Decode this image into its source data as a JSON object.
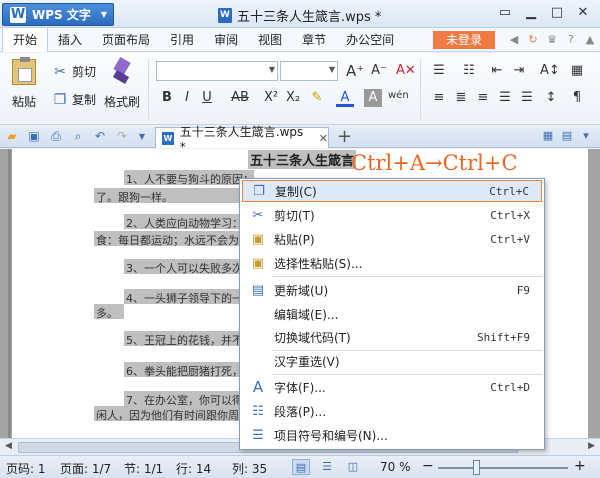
{
  "titlebar": {
    "app_name": "WPS 文字",
    "doc_title": "五十三条人生箴言.wps *",
    "win_ctrls": [
      "▭",
      "▁",
      "□",
      "✕"
    ]
  },
  "menubar": {
    "items": [
      "开始",
      "插入",
      "页面布局",
      "引用",
      "审阅",
      "视图",
      "章节",
      "办公空间"
    ],
    "login": "未登录"
  },
  "ribbon": {
    "paste": "粘贴",
    "cut": "剪切",
    "copy": "复制",
    "format_painter": "格式刷"
  },
  "tabbar": {
    "doc_tab": "五十三条人生箴言.wps *"
  },
  "document": {
    "heading": "五十三条人生箴言",
    "lines": [
      "1、人不要与狗斗的原因：",
      "了。跟狗一样。",
      "2、人类应向动物学习：",
      "食：每日都运动；水远不会为",
      "3、一个人可以失败多次，",
      "4、一头狮子领导下的一",
      "多。",
      "5、王冠上的花钱，并不",
      "6、拳头能把厨猪打死，",
      "7、在办公室，你可以得",
      "闲人，因为他们有时间跟你周"
    ],
    "overlay": "Ctrl+A→Ctrl+C"
  },
  "context_menu": {
    "items": [
      {
        "label": "复制(C)",
        "shortcut": "Ctrl+C"
      },
      {
        "label": "剪切(T)",
        "shortcut": "Ctrl+X"
      },
      {
        "label": "粘贴(P)",
        "shortcut": "Ctrl+V"
      },
      {
        "label": "选择性粘贴(S)...",
        "shortcut": ""
      },
      {
        "label": "更新域(U)",
        "shortcut": "F9"
      },
      {
        "label": "编辑域(E)...",
        "shortcut": ""
      },
      {
        "label": "切换域代码(T)",
        "shortcut": "Shift+F9"
      },
      {
        "label": "汉字重选(V)",
        "shortcut": ""
      },
      {
        "label": "字体(F)...",
        "shortcut": "Ctrl+D"
      },
      {
        "label": "段落(P)...",
        "shortcut": ""
      },
      {
        "label": "项目符号和编号(N)...",
        "shortcut": ""
      }
    ]
  },
  "statusbar": {
    "page_code": "页码: 1",
    "page": "页面: 1/7",
    "section": "节: 1/1",
    "row": "行: 14",
    "col": "列: 35",
    "zoom": "70 %"
  },
  "colors": {
    "accent": "#2c6cc0",
    "login": "#f07a42",
    "overlay": "#e8661e",
    "highlight_border": "#e8823f"
  }
}
